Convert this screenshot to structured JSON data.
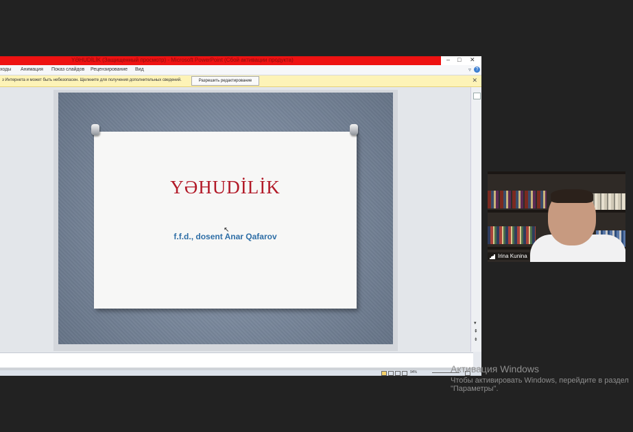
{
  "window": {
    "title": "YƏHUDİLİK (Защищенный просмотр) - Microsoft PowerPoint (Сбой активации продукта)",
    "controls": [
      "–",
      "□",
      "✕"
    ]
  },
  "ribbon": {
    "tabs": [
      "ходы",
      "Анимация",
      "Показ слайдов",
      "Рецензирование",
      "Вид"
    ],
    "help_label": "?"
  },
  "message_bar": {
    "text": "з Интернета и может быть небезопасен. Щелкните для получения дополнительных сведений.",
    "button_label": "Разрешить редактирование",
    "close_label": "✕"
  },
  "slide": {
    "title": "YƏHUDİLİK",
    "subtitle": "f.f.d., dosent Anar Qafarov"
  },
  "status_bar": {
    "zoom": "94%"
  },
  "webcam": {
    "participant_name": "Irina Kunina"
  },
  "activation": {
    "heading": "Активация Windows",
    "line1": "Чтобы активировать Windows, перейдите в раздел",
    "line2": "\"Параметры\"."
  },
  "colors": {
    "titlebar": "#ee1212",
    "slide_title": "#b21a28",
    "slide_subtitle": "#2e6ea6",
    "message_bar": "#fdf3b7"
  }
}
